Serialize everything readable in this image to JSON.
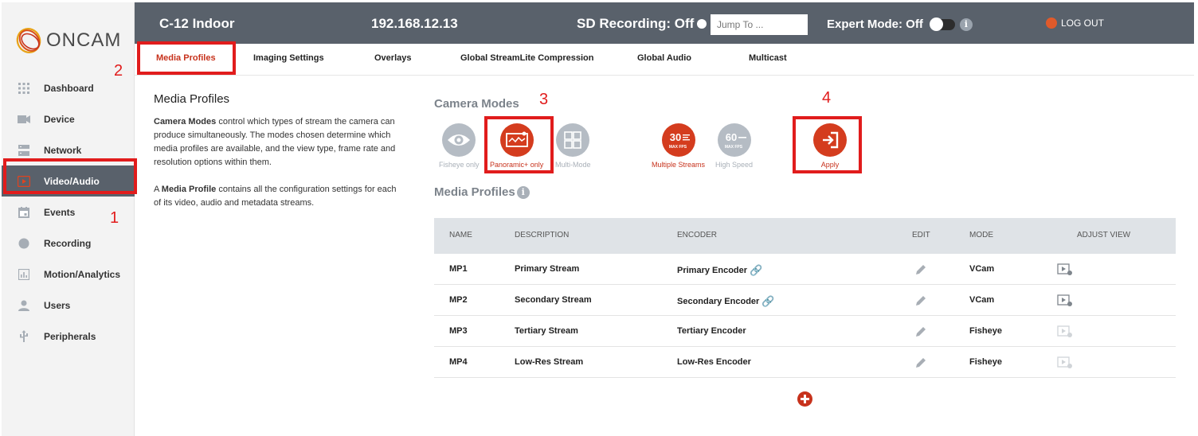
{
  "logo": {
    "text": "ONCAM"
  },
  "sidebar": {
    "items": [
      {
        "label": "Dashboard",
        "icon": "grid-icon"
      },
      {
        "label": "Device",
        "icon": "camera-icon"
      },
      {
        "label": "Network",
        "icon": "network-icon"
      },
      {
        "label": "Video/Audio",
        "icon": "video-icon"
      },
      {
        "label": "Events",
        "icon": "calendar-icon"
      },
      {
        "label": "Recording",
        "icon": "record-icon"
      },
      {
        "label": "Motion/Analytics",
        "icon": "chart-icon"
      },
      {
        "label": "Users",
        "icon": "user-icon"
      },
      {
        "label": "Peripherals",
        "icon": "usb-icon"
      }
    ],
    "active": "Video/Audio"
  },
  "header": {
    "camera_name": "C-12 Indoor",
    "ip": "192.168.12.13",
    "sd_recording": "SD Recording: Off",
    "jump_placeholder": "Jump To ...",
    "expert_mode": "Expert Mode: Off",
    "logout": "LOG OUT"
  },
  "tabs": [
    {
      "label": "Media Profiles",
      "active": true
    },
    {
      "label": "Imaging Settings"
    },
    {
      "label": "Overlays"
    },
    {
      "label": "Global StreamLite Compression"
    },
    {
      "label": "Global Audio"
    },
    {
      "label": "Multicast"
    }
  ],
  "description": {
    "title": "Media Profiles",
    "p1_bold": "Camera Modes",
    "p1_rest": " control which types of stream the camera can produce simultaneously. The modes chosen determine which media profiles are available, and the view type, frame rate and resolution options within them.",
    "p2_a": "A ",
    "p2_bold": "Media Profile",
    "p2_rest": " contains all the configuration settings for each of its video, audio and metadata streams."
  },
  "camera_modes": {
    "title": "Camera Modes",
    "modes": [
      {
        "label": "Fisheye only",
        "icon": "fisheye-icon",
        "selected": false
      },
      {
        "label": "Panoramic+ only",
        "icon": "panoramic-icon",
        "selected": true
      },
      {
        "label": "Multi-Mode",
        "icon": "multi-mode-icon",
        "selected": false
      },
      {
        "label": "Multiple Streams",
        "icon": "fps-30-icon",
        "selected": true,
        "badge": "30",
        "badge_sub": "MAX FPS"
      },
      {
        "label": "High Speed",
        "icon": "fps-60-icon",
        "selected": false,
        "badge": "60",
        "badge_sub": "MAX FPS"
      }
    ],
    "apply_label": "Apply"
  },
  "media_profiles": {
    "title": "Media Profiles",
    "columns": [
      "NAME",
      "DESCRIPTION",
      "ENCODER",
      "EDIT",
      "MODE",
      "ADJUST VIEW"
    ],
    "rows": [
      {
        "name": "MP1",
        "description": "Primary Stream",
        "encoder": "Primary Encoder",
        "linked": true,
        "mode": "VCam",
        "adjust_enabled": true
      },
      {
        "name": "MP2",
        "description": "Secondary Stream",
        "encoder": "Secondary Encoder",
        "linked": true,
        "mode": "VCam",
        "adjust_enabled": true
      },
      {
        "name": "MP3",
        "description": "Tertiary Stream",
        "encoder": "Tertiary Encoder",
        "linked": false,
        "mode": "Fisheye",
        "adjust_enabled": false
      },
      {
        "name": "MP4",
        "description": "Low-Res Stream",
        "encoder": "Low-Res Encoder",
        "linked": false,
        "mode": "Fisheye",
        "adjust_enabled": false
      }
    ]
  },
  "annotations": [
    "1",
    "2",
    "3",
    "4"
  ],
  "colors": {
    "accent": "#c7321c",
    "header_bg": "#59616b",
    "annotation": "#e11c1c"
  }
}
